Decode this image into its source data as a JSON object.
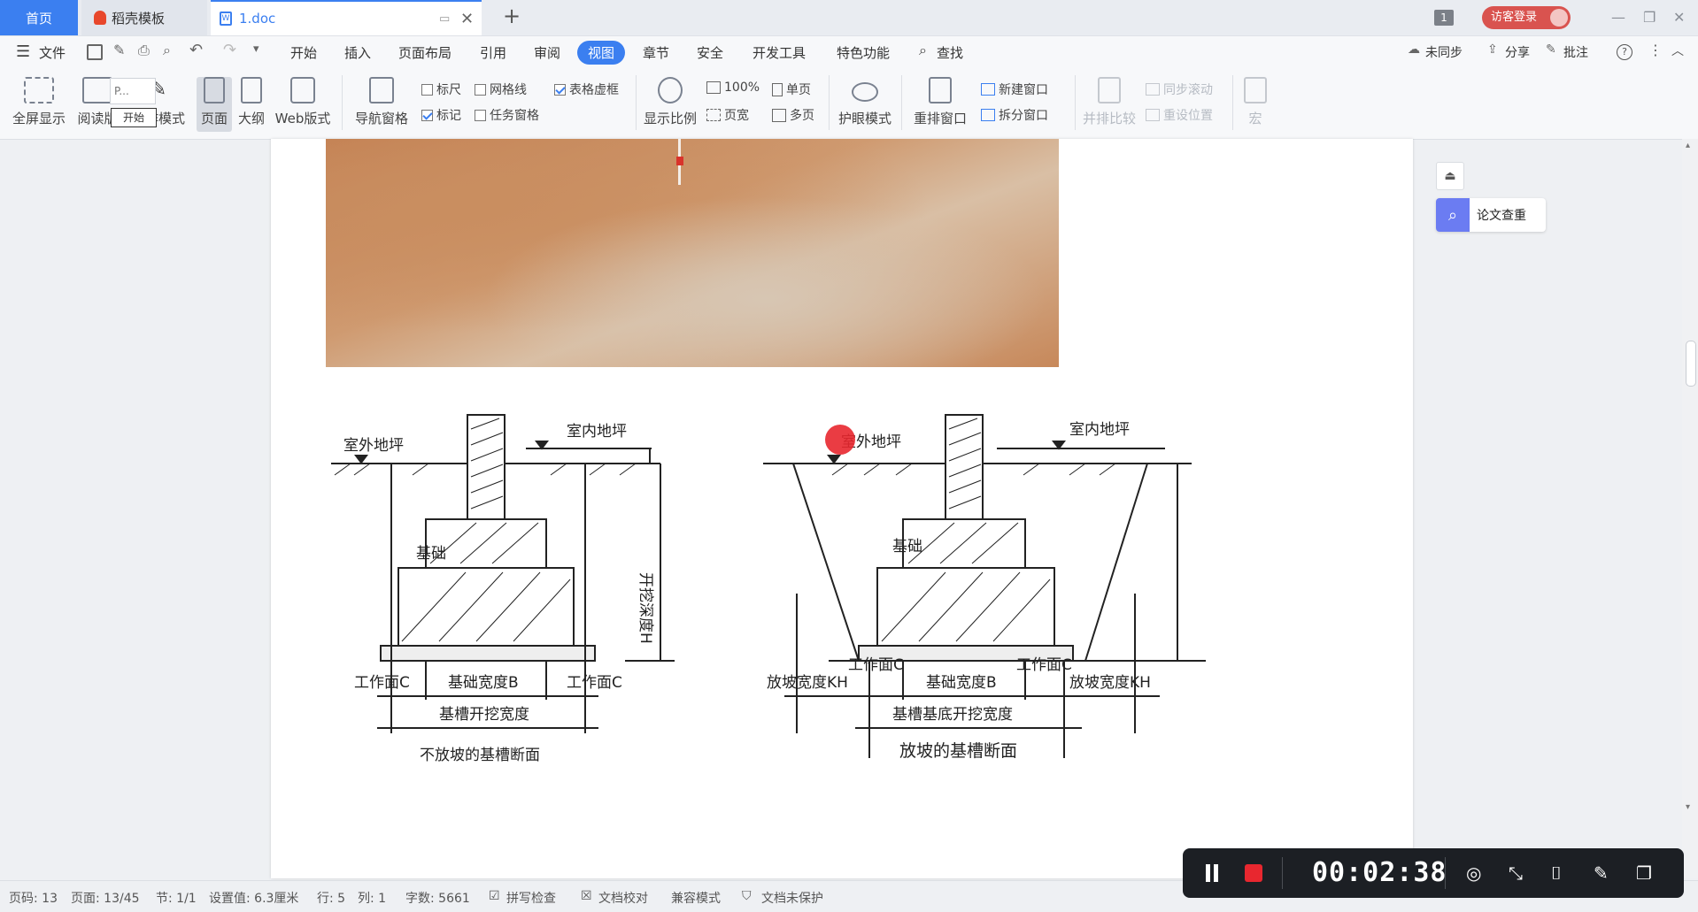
{
  "titlebar": {
    "tabs": [
      {
        "label": "首页"
      },
      {
        "label": "稻壳模板"
      },
      {
        "label": "1.doc"
      }
    ],
    "badge": "1",
    "login_label": "访客登录"
  },
  "menubar": {
    "file": "文件",
    "items": [
      "开始",
      "插入",
      "页面布局",
      "引用",
      "审阅",
      "视图",
      "章节",
      "安全",
      "开发工具",
      "特色功能"
    ],
    "search": "查找",
    "sync": "未同步",
    "share": "分享",
    "comment": "批注"
  },
  "toolbar": {
    "fullscreen": "全屏显示",
    "reading": "阅读版",
    "write_mode": "写作模式",
    "page": "页面",
    "outline": "大纲",
    "web": "Web版式",
    "nav_pane": "导航窗格",
    "ruler": "标尺",
    "gridlines": "网格线",
    "table_frame": "表格虚框",
    "marks": "标记",
    "task_pane": "任务窗格",
    "zoom": "显示比例",
    "zoom_100": "100%",
    "page_width": "页宽",
    "single_page": "单页",
    "multi_page": "多页",
    "eye_mode": "护眼模式",
    "rearrange": "重排窗口",
    "new_window": "新建窗口",
    "split_window": "拆分窗口",
    "side_by_side": "并排比较",
    "sync_scroll": "同步滚动",
    "reset_pos": "重设位置",
    "macro": "宏",
    "tooltip": "开始",
    "mini_page": "P..."
  },
  "checkboxes": {
    "ruler": false,
    "gridlines": false,
    "table_frame": true,
    "marks": true,
    "task_pane": false
  },
  "diagram": {
    "left": {
      "outdoor": "室外地坪",
      "indoor": "室内地坪",
      "foundation": "基础",
      "depth": "开挖深度H",
      "work_face_l": "工作面C",
      "width_b": "基础宽度B",
      "work_face_r": "工作面C",
      "trench_width": "基槽开挖宽度",
      "caption": "不放坡的基槽断面"
    },
    "right": {
      "outdoor": "室外地坪",
      "indoor": "室内地坪",
      "foundation": "基础",
      "work_face_l": "工作面C",
      "work_face_r": "工作面C",
      "slope_l": "放坡宽度KH",
      "width_b": "基础宽度B",
      "slope_r": "放坡宽度KH",
      "trench_width": "基槽基底开挖宽度",
      "caption": "放坡的基槽断面"
    }
  },
  "right_panel": {
    "check_label": "论文查重"
  },
  "statusbar": {
    "page_code": "页码: 13",
    "page": "页面: 13/45",
    "section": "节: 1/1",
    "setting": "设置值: 6.3厘米",
    "row": "行: 5",
    "col": "列: 1",
    "words": "字数: 5661",
    "spell": "拼写检查",
    "proof": "文档校对",
    "compat": "兼容模式",
    "protect": "文档未保护"
  },
  "recorder": {
    "time": "00:02:38"
  },
  "colors": {
    "accent": "#3b7ff0",
    "recorder_bg": "#1c1f24",
    "record_red": "#e8272f",
    "login_bg": "#d9534f"
  }
}
